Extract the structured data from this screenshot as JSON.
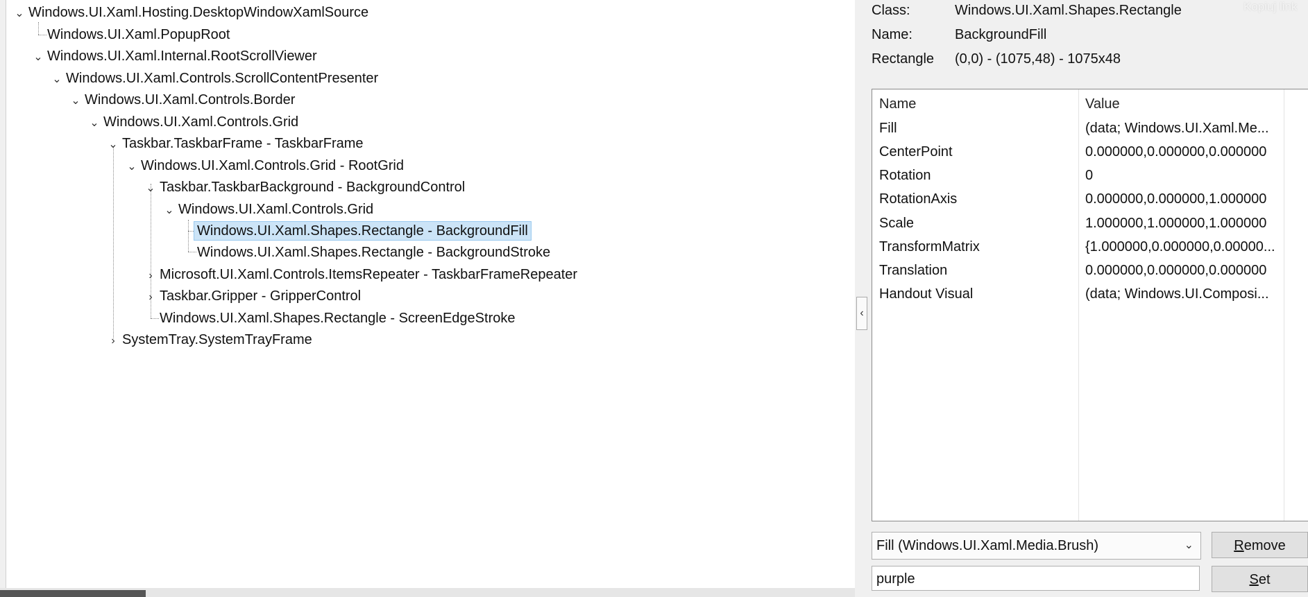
{
  "tree": {
    "nodes": [
      {
        "text": "Windows.UI.Xaml.Hosting.DesktopWindowXamlSource",
        "expander": "⌄"
      },
      {
        "text": "Windows.UI.Xaml.PopupRoot",
        "expander": ""
      },
      {
        "text": "Windows.UI.Xaml.Internal.RootScrollViewer",
        "expander": "⌄"
      },
      {
        "text": "Windows.UI.Xaml.Controls.ScrollContentPresenter",
        "expander": "⌄"
      },
      {
        "text": "Windows.UI.Xaml.Controls.Border",
        "expander": "⌄"
      },
      {
        "text": "Windows.UI.Xaml.Controls.Grid",
        "expander": "⌄"
      },
      {
        "text": "Taskbar.TaskbarFrame - TaskbarFrame",
        "expander": "⌄"
      },
      {
        "text": "Windows.UI.Xaml.Controls.Grid - RootGrid",
        "expander": "⌄"
      },
      {
        "text": "Taskbar.TaskbarBackground - BackgroundControl",
        "expander": "⌄"
      },
      {
        "text": "Windows.UI.Xaml.Controls.Grid",
        "expander": "⌄"
      },
      {
        "text": "Windows.UI.Xaml.Shapes.Rectangle - BackgroundFill",
        "expander": "",
        "selected": true
      },
      {
        "text": "Windows.UI.Xaml.Shapes.Rectangle - BackgroundStroke",
        "expander": ""
      },
      {
        "text": "Microsoft.UI.Xaml.Controls.ItemsRepeater - TaskbarFrameRepeater",
        "expander": "›"
      },
      {
        "text": "Taskbar.Gripper - GripperControl",
        "expander": "›"
      },
      {
        "text": "Windows.UI.Xaml.Shapes.Rectangle - ScreenEdgeStroke",
        "expander": ""
      },
      {
        "text": "SystemTray.SystemTrayFrame",
        "expander": "›"
      }
    ]
  },
  "details": {
    "class_label": "Class:",
    "class_value": "Windows.UI.Xaml.Shapes.Rectangle",
    "name_label": "Name:",
    "name_value": "BackgroundFill",
    "rect_label": "Rectangle",
    "rect_value": "(0,0) - (1075,48)  -  1075x48"
  },
  "corner_text": "Kopiuj link",
  "properties": {
    "header": {
      "name": "Name",
      "value": "Value"
    },
    "rows": [
      {
        "name": "Fill",
        "value": "(data; Windows.UI.Xaml.Me..."
      },
      {
        "name": "CenterPoint",
        "value": "0.000000,0.000000,0.000000"
      },
      {
        "name": "Rotation",
        "value": "0"
      },
      {
        "name": "RotationAxis",
        "value": "0.000000,0.000000,1.000000"
      },
      {
        "name": "Scale",
        "value": "1.000000,1.000000,1.000000"
      },
      {
        "name": "TransformMatrix",
        "value": "{1.000000,0.000000,0.00000..."
      },
      {
        "name": "Translation",
        "value": "0.000000,0.000000,0.000000"
      },
      {
        "name": "Handout Visual",
        "value": "(data; Windows.UI.Composi..."
      }
    ]
  },
  "editor": {
    "type_selected": "Fill (Windows.UI.Xaml.Media.Brush)",
    "value": "purple",
    "remove_label_u": "R",
    "remove_label_rest": "emove",
    "set_label_u": "S",
    "set_label_rest": "et"
  },
  "icons": {
    "expand": "chevron-down-icon",
    "collapsed": "chevron-right-icon",
    "pane_toggle": "chevron-left-icon",
    "dropdown": "chevron-down-icon"
  }
}
